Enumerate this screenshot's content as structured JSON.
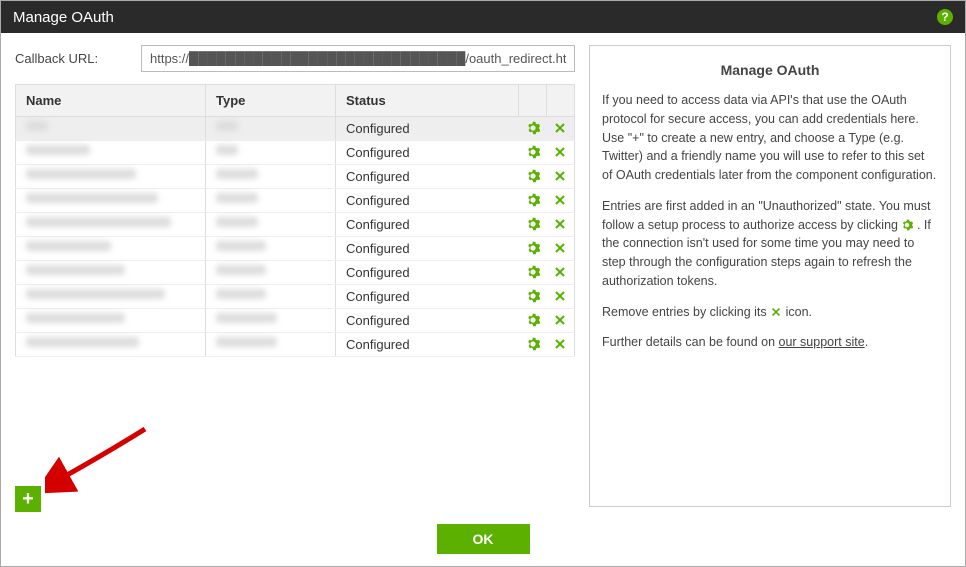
{
  "titlebar": {
    "title": "Manage OAuth"
  },
  "callback": {
    "label": "Callback URL:",
    "value": "https://██████████████████████████████/oauth_redirect.html"
  },
  "columns": {
    "name": "Name",
    "type": "Type",
    "status": "Status"
  },
  "rows": [
    {
      "name_masked": "Box",
      "type_masked": "Box",
      "status": "Configured",
      "selected": true
    },
    {
      "name_masked": "BoxAccess",
      "type_masked": "Box",
      "status": "Configured"
    },
    {
      "name_masked": "Google PROD Test",
      "type_masked": "Google",
      "status": "Configured"
    },
    {
      "name_masked": "GoogleAnalyticsPROD",
      "type_masked": "Google",
      "status": "Configured"
    },
    {
      "name_masked": "GoogleAnalyticsPRODv2",
      "type_masked": "Google",
      "status": "Configured"
    },
    {
      "name_masked": "NetsuitePROD",
      "type_masked": "NetSuite",
      "status": "Configured"
    },
    {
      "name_masked": "NetsuiteSandbox",
      "type_masked": "NetSuite",
      "status": "Configured"
    },
    {
      "name_masked": "NetsuiteSandboxAltAcct",
      "type_masked": "NetSuite",
      "status": "Configured"
    },
    {
      "name_masked": "SalesforcePROD",
      "type_masked": "Salesforce",
      "status": "Configured"
    },
    {
      "name_masked": "SalesforceSandbox",
      "type_masked": "Salesforce",
      "status": "Configured"
    }
  ],
  "help": {
    "title": "Manage OAuth",
    "p1": "If you need to access data via API's that use the OAuth protocol for secure access, you can add credentials here. Use \"+\" to create a new entry, and choose a Type (e.g. Twitter) and a friendly name you will use to refer to this set of OAuth credentials later from the component configuration.",
    "p2a": "Entries are first added in an \"Unauthorized\" state. You must follow a setup process to authorize access by clicking ",
    "p2b": ". If the connection isn't used for some time you may need to step through the configuration steps again to refresh the authorization tokens.",
    "p3a": "Remove entries by clicking its ",
    "p3b": " icon.",
    "p4a": "Further details can be found on ",
    "linktext": "our support site",
    "p4b": "."
  },
  "buttons": {
    "ok": "OK",
    "add": "+"
  }
}
